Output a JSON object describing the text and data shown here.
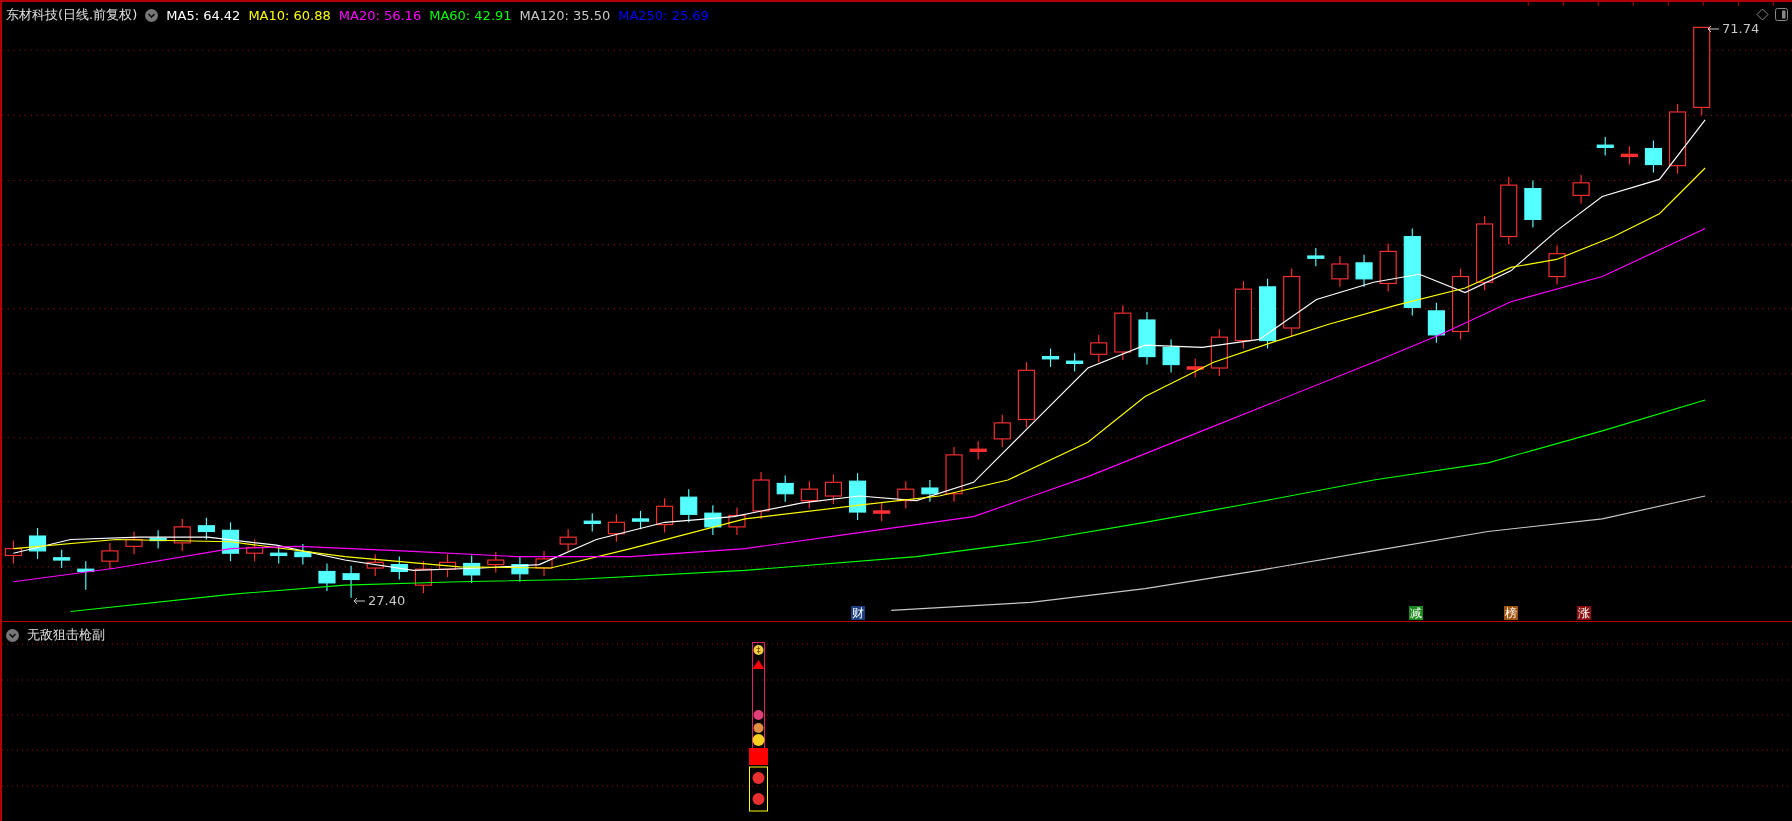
{
  "chart": {
    "title": "东材科技(日线.前复权)",
    "moving_averages": [
      {
        "label": "MA5: 64.42",
        "color": "#ffffff"
      },
      {
        "label": "MA10: 60.88",
        "color": "#ffff00"
      },
      {
        "label": "MA20: 56.16",
        "color": "#ff00ff"
      },
      {
        "label": "MA60: 42.91",
        "color": "#00ff00"
      },
      {
        "label": "MA120: 35.50",
        "color": "#c8c8c8"
      },
      {
        "label": "MA250: 25.69",
        "color": "#0000ff"
      }
    ],
    "high_label": "71.74",
    "low_label": "27.40",
    "event_markers": [
      {
        "text": "财",
        "color": "#1c3f82"
      },
      {
        "text": "减",
        "color": "#1a8a1a"
      },
      {
        "text": "榜",
        "color": "#a0520f"
      },
      {
        "text": "涨",
        "color": "#8a0f0f"
      }
    ]
  },
  "indicator_panel": {
    "title": "无敌狙击枪副"
  }
}
